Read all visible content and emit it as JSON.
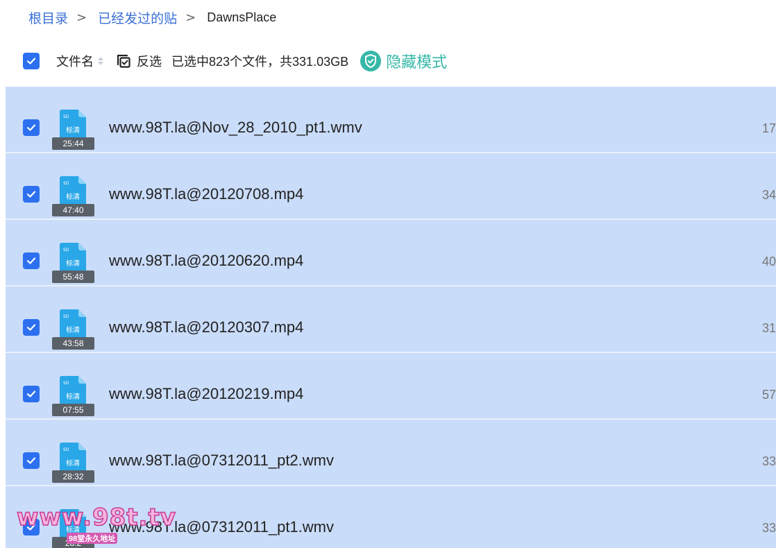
{
  "breadcrumb": {
    "items": [
      "根目录",
      "已经发过的贴"
    ],
    "current": "DawnsPlace",
    "separator": ">"
  },
  "toolbar": {
    "column_name": "文件名",
    "invert_label": "反选",
    "selected_info": "已选中823个文件，共331.03GB",
    "hidden_mode_label": "隐藏模式"
  },
  "files": [
    {
      "name": "www.98T.la@Nov_28_2010_pt1.wmv",
      "duration": "25:44",
      "size": "17",
      "badge_top": "SD",
      "badge_label": "标清"
    },
    {
      "name": "www.98T.la@20120708.mp4",
      "duration": "47:40",
      "size": "34",
      "badge_top": "SD",
      "badge_label": "标清"
    },
    {
      "name": "www.98T.la@20120620.mp4",
      "duration": "55:48",
      "size": "40",
      "badge_top": "SD",
      "badge_label": "标清"
    },
    {
      "name": "www.98T.la@20120307.mp4",
      "duration": "43:58",
      "size": "31",
      "badge_top": "SD",
      "badge_label": "标清"
    },
    {
      "name": "www.98T.la@20120219.mp4",
      "duration": "07:55",
      "size": "57",
      "badge_top": "SD",
      "badge_label": "标清"
    },
    {
      "name": "www.98T.la@07312011_pt2.wmv",
      "duration": "28:32",
      "size": "33",
      "badge_top": "SD",
      "badge_label": "标清"
    },
    {
      "name": "www.98T.la@07312011_pt1.wmv",
      "duration": "28:2",
      "size": "33",
      "badge_top": "SD",
      "badge_label": "标清"
    }
  ],
  "watermark": {
    "text": "www.98t.tv",
    "subtext": "98堂永久地址"
  },
  "colors": {
    "accent": "#2c70f0",
    "selection_bg": "#c9dcf9",
    "hidden_mode": "#36b8a8",
    "file_icon": "#29a7e8"
  }
}
